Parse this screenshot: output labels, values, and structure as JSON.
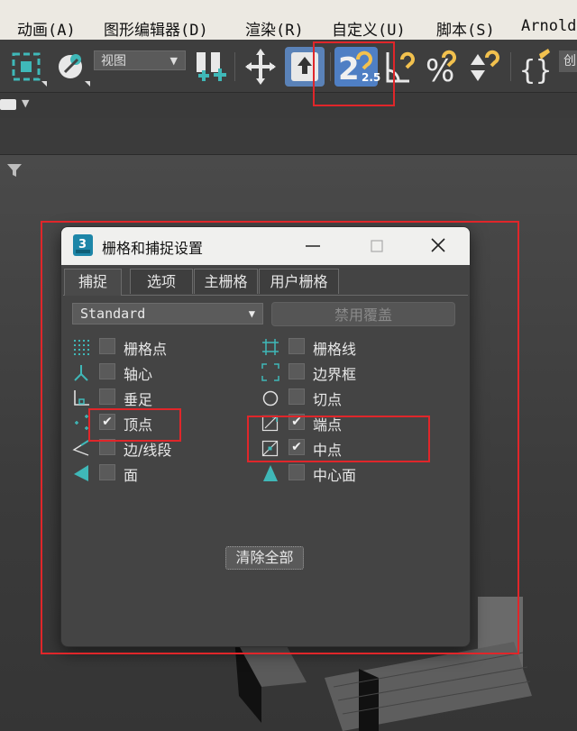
{
  "menu": {
    "items": [
      "动画(A)",
      "图形编辑器(D)",
      "渲染(R)",
      "自定义(U)",
      "脚本(S)",
      "Arnold"
    ]
  },
  "toolbar": {
    "view_dropdown": "视图",
    "snap_toggle_label": "2.5",
    "tail_label": "创"
  },
  "dialog": {
    "title": "栅格和捕捉设置",
    "app_icon_label": "3",
    "tabs": [
      "捕捉",
      "选项",
      "主栅格",
      "用户栅格"
    ],
    "active_tab": "捕捉",
    "preset_dropdown": "Standard",
    "override_button": "禁用覆盖",
    "snaps_left": [
      {
        "label": "栅格点",
        "checked": false,
        "icon": "grid-points-icon"
      },
      {
        "label": "轴心",
        "checked": false,
        "icon": "pivot-icon"
      },
      {
        "label": "垂足",
        "checked": false,
        "icon": "perpendicular-icon"
      },
      {
        "label": "顶点",
        "checked": true,
        "icon": "vertex-icon"
      },
      {
        "label": "边/线段",
        "checked": false,
        "icon": "edge-segment-icon"
      },
      {
        "label": "面",
        "checked": false,
        "icon": "face-icon"
      }
    ],
    "snaps_right": [
      {
        "label": "栅格线",
        "checked": false,
        "icon": "grid-lines-icon"
      },
      {
        "label": "边界框",
        "checked": false,
        "icon": "bounding-box-icon"
      },
      {
        "label": "切点",
        "checked": false,
        "icon": "tangent-icon"
      },
      {
        "label": "端点",
        "checked": true,
        "icon": "endpoint-icon"
      },
      {
        "label": "中点",
        "checked": true,
        "icon": "midpoint-icon"
      },
      {
        "label": "中心面",
        "checked": false,
        "icon": "center-face-icon"
      }
    ],
    "clear_all_button": "清除全部",
    "check_glyph": "✔"
  },
  "colors": {
    "accent_teal": "#3fb8b8",
    "snap_yellow": "#f2c14e",
    "highlight_red": "#e0262a",
    "active_tool_blue": "#4f7fc4"
  }
}
